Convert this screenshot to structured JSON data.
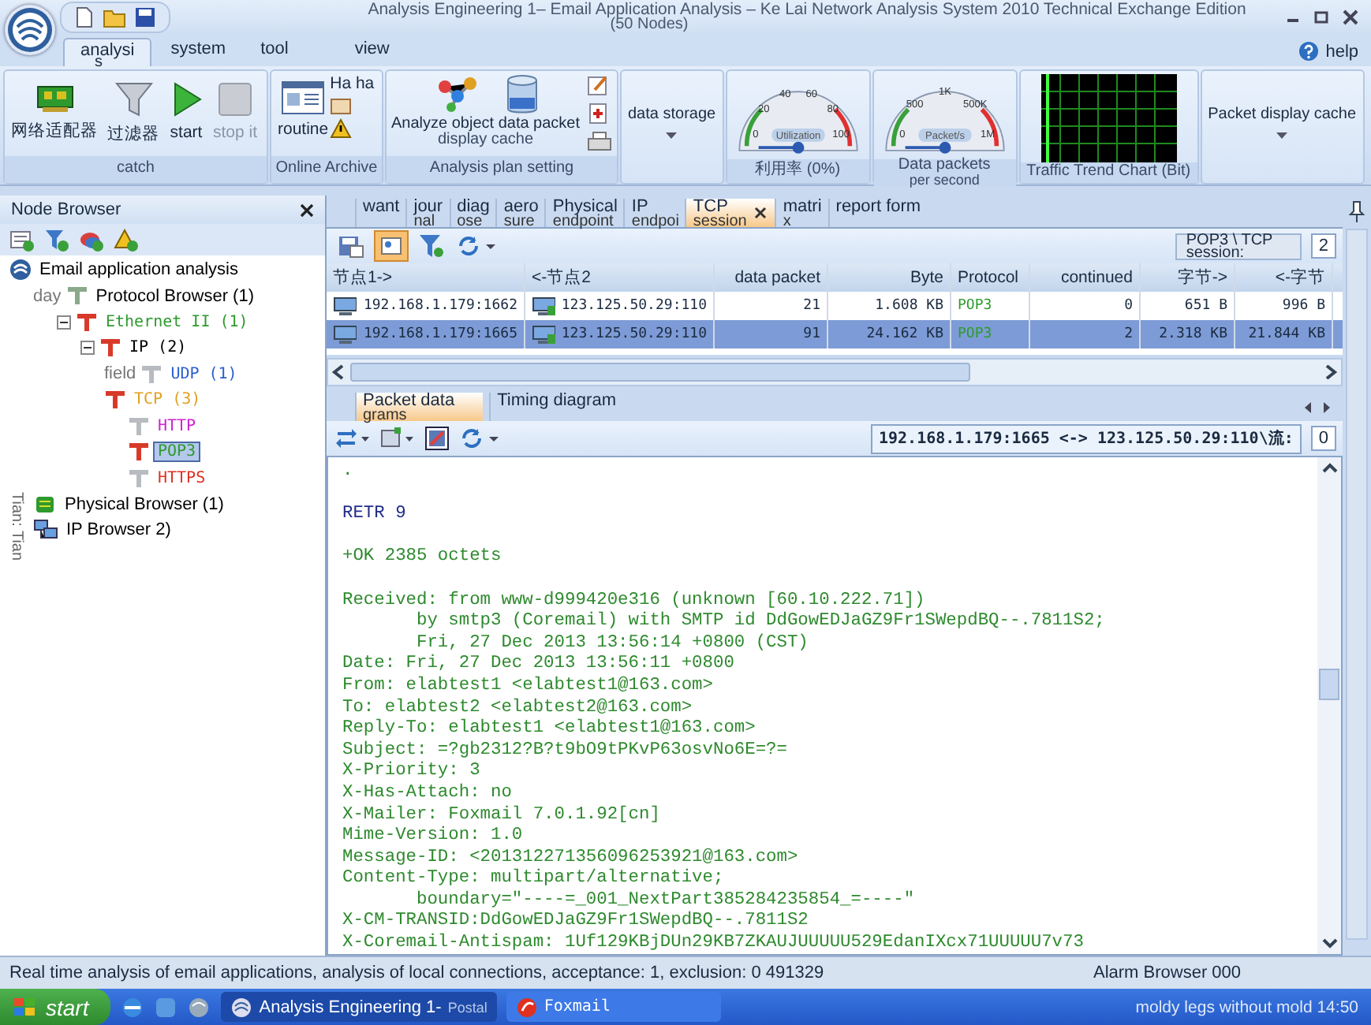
{
  "window": {
    "title": "Analysis Engineering 1– Email Application Analysis – Ke Lai Network Analysis System 2010 Technical Exchange Edition",
    "subtitle": "(50 Nodes)"
  },
  "menu_tabs": [
    {
      "label": "analysi",
      "sublabel": "s",
      "selected": true
    },
    {
      "label": "system",
      "selected": false
    },
    {
      "label": "tool",
      "selected": false
    },
    {
      "label": "view",
      "selected": false
    }
  ],
  "help": "help",
  "ribbon": [
    {
      "kind": "buttons",
      "label": "catch",
      "buttons": [
        {
          "label": "网络适配器",
          "disabled": false
        },
        {
          "label": "过滤器",
          "disabled": false
        },
        {
          "label": "start",
          "disabled": false
        },
        {
          "label": "stop it",
          "disabled": true
        }
      ]
    },
    {
      "kind": "archive",
      "label": "Online Archive",
      "button": "routine",
      "note": "Ha ha"
    },
    {
      "kind": "plan",
      "label": "Analysis plan setting",
      "button": "Analyze object data packet",
      "sub": "display cache"
    },
    {
      "kind": "dropdown",
      "button": "data storage"
    },
    {
      "kind": "gauge",
      "unit": "Utilization",
      "ticks": [
        "0",
        "20",
        "40",
        "60",
        "80",
        "100"
      ],
      "label": "利用率 (0%)"
    },
    {
      "kind": "gauge",
      "unit": "Packet/s",
      "ticks": [
        "0",
        "500",
        "1K",
        "500K",
        "1M"
      ],
      "label": "Data packets",
      "label2": "per second"
    },
    {
      "kind": "trend",
      "label": "Traffic Trend Chart (Bit)"
    },
    {
      "kind": "dropdown",
      "button": "Packet display cache"
    }
  ],
  "node_browser": {
    "title": "Node Browser",
    "side_note": "Tian: Tian",
    "tree": [
      {
        "kind": "app",
        "label": "Email application analysis",
        "color": "#000000",
        "selected": false,
        "children": [
          {
            "kind": "browser",
            "prefix": "day",
            "label": "Protocol Browser (1)",
            "color": "#000000",
            "active": false,
            "selected": false,
            "children": [
              {
                "kind": "protocol",
                "label": "Ethernet II (1)",
                "color": "#2e9a2e",
                "active": true,
                "expanded": true,
                "selected": false,
                "children": [
                  {
                    "kind": "protocol",
                    "label": "IP (2)",
                    "color": "#000000",
                    "active": true,
                    "expanded": true,
                    "selected": false,
                    "children": [
                      {
                        "kind": "protocol",
                        "prefix": "field",
                        "label": "UDP (1)",
                        "color": "#2a5fd0",
                        "active": false,
                        "selected": false
                      },
                      {
                        "kind": "protocol",
                        "label": "TCP (3)",
                        "color": "#e0a020",
                        "active": true,
                        "selected": false,
                        "children": [
                          {
                            "kind": "protocol",
                            "label": "HTTP",
                            "color": "#d020d0",
                            "active": false,
                            "selected": false
                          },
                          {
                            "kind": "protocol",
                            "label": "POP3",
                            "color": "#2e9a2e",
                            "active": true,
                            "selected": true
                          },
                          {
                            "kind": "protocol",
                            "label": "HTTPS",
                            "color": "#e03020",
                            "active": false,
                            "selected": false
                          }
                        ]
                      }
                    ]
                  }
                ]
              }
            ]
          },
          {
            "kind": "physical",
            "label": "Physical Browser (1)",
            "color": "#000000",
            "selected": false
          },
          {
            "kind": "network",
            "label": "IP Browser 2)",
            "color": "#000000",
            "selected": false
          }
        ]
      }
    ]
  },
  "view_tabs": [
    {
      "label": "want",
      "selected": false
    },
    {
      "label": "jour",
      "sublabel": "nal",
      "selected": false
    },
    {
      "label": "diag",
      "sublabel": "ose",
      "selected": false
    },
    {
      "label": "aero",
      "sublabel": "sure",
      "selected": false
    },
    {
      "label": "Physical",
      "sublabel": "endpoint",
      "selected": false
    },
    {
      "label": "IP",
      "sublabel": "endpoi",
      "selected": false
    },
    {
      "label": "TCP",
      "sublabel": "session",
      "selected": true,
      "closable": true
    },
    {
      "label": "matri",
      "sublabel": "x",
      "selected": false
    },
    {
      "label": "report form",
      "selected": false
    }
  ],
  "session_filter": {
    "label": "POP3 \\ TCP",
    "sublabel": "session:",
    "count": "2"
  },
  "table": {
    "columns": [
      "节点1->",
      "<-节点2",
      "data packet",
      "Byte",
      "Protocol",
      "continued",
      "字节->",
      "<-字节"
    ],
    "rows": [
      {
        "selected": false,
        "cells": [
          "192.168.1.179:1662",
          "123.125.50.29:110",
          "21",
          "1.608 KB",
          "POP3",
          "0",
          "651  B",
          "996  B"
        ]
      },
      {
        "selected": true,
        "cells": [
          "192.168.1.179:1665",
          "123.125.50.29:110",
          "91",
          "24.162 KB",
          "POP3",
          "2",
          "2.318 KB",
          "21.844 KB"
        ]
      }
    ]
  },
  "detail_tabs": [
    {
      "label": "Packet data",
      "sublabel": "grams",
      "selected": true
    },
    {
      "label": "Timing diagram",
      "selected": false
    }
  ],
  "stream": {
    "label": "192.168.1.179:1665 <-> 123.125.50.29:110\\流:",
    "value": "0"
  },
  "blocks": [
    {
      "kind": "server",
      "lines": [
        "."
      ]
    },
    {
      "kind": "client",
      "lines": [
        "RETR 9"
      ]
    },
    {
      "kind": "server",
      "lines": [
        "+OK 2385 octets"
      ]
    },
    {
      "kind": "server",
      "lines": [
        "Received: from www-d999420e316 (unknown [60.10.222.71])",
        "       by smtp3 (Coremail) with SMTP id DdGowEDJaGZ9Fr1SWepdBQ--.7811S2;",
        "       Fri, 27 Dec 2013 13:56:14 +0800 (CST)",
        "Date: Fri, 27 Dec 2013 13:56:11 +0800",
        "From: elabtest1 <elabtest1@163.com>",
        "To: elabtest2 <elabtest2@163.com>",
        "Reply-To: elabtest1 <elabtest1@163.com>",
        "Subject: =?gb2312?B?t9bO9tPKvP63osvNo6E=?=",
        "X-Priority: 3",
        "X-Has-Attach: no",
        "X-Mailer: Foxmail 7.0.1.92[cn]",
        "Mime-Version: 1.0",
        "Message-ID: <201312271356096253921@163.com>",
        "Content-Type: multipart/alternative;",
        "       boundary=\"----=_001_NextPart385284235854_=----\"",
        "X-CM-TRANSID:DdGowEDJaGZ9Fr1SWepdBQ--.7811S2",
        "X-Coremail-Antispam: 1Uf129KBjDUn29KB7ZKAUJUUUUU529EdanIXcx71UUUUU7v73"
      ]
    }
  ],
  "status_bar": {
    "message": "Real time analysis of email applications, analysis of local connections, acceptance: 1, exclusion: 0 491329",
    "alarm": "Alarm Browser 000"
  },
  "taskbar": {
    "start": "start",
    "tasks": [
      {
        "label": "Analysis Engineering 1-",
        "sub": "Postal",
        "selected": true
      },
      {
        "label": "Foxmail",
        "selected": false
      }
    ],
    "tray": "moldy legs without mold 14:50"
  }
}
